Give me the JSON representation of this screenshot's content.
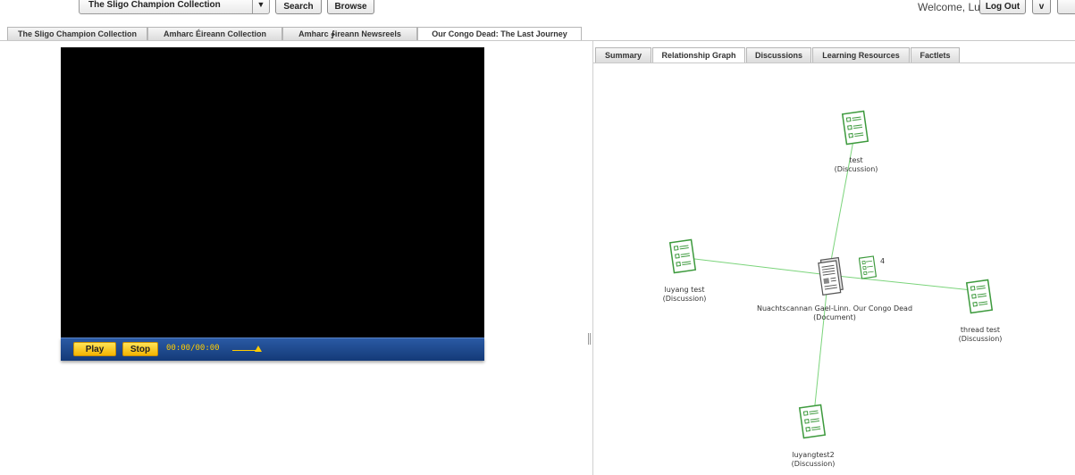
{
  "topbar": {
    "collection_select": "The Sligo Champion Collection",
    "search_label": "Search",
    "browse_label": "Browse",
    "welcome_text": "Welcome, Lu",
    "logout_label": "Log Out"
  },
  "collection_tabs": [
    {
      "label": "The Sligo Champion Collection"
    },
    {
      "label": "Amharc Éireann Collection"
    },
    {
      "label": "Amharc ∲ireann Newsreels"
    },
    {
      "label": "Our Congo Dead: The Last Journey"
    }
  ],
  "player": {
    "play_label": "Play",
    "stop_label": "Stop",
    "timecode": "00:00/00:00"
  },
  "right_tabs": [
    {
      "label": "Summary"
    },
    {
      "label": "Relationship Graph"
    },
    {
      "label": "Discussions"
    },
    {
      "label": "Learning Resources"
    },
    {
      "label": "Factlets"
    }
  ],
  "graph": {
    "center": {
      "name": "Nuachtscannan Gael-Linn.  Our Congo Dead",
      "type": "(Document)"
    },
    "count_badge": "4",
    "nodes": [
      {
        "name": "test",
        "type": "(Discussion)"
      },
      {
        "name": "luyang test",
        "type": "(Discussion)"
      },
      {
        "name": "thread test",
        "type": "(Discussion)"
      },
      {
        "name": "luyangtest2",
        "type": "(Discussion)"
      }
    ]
  },
  "colors": {
    "edge": "#7bd47b",
    "discussion_icon": "#3d9a3d",
    "controls_bar": "#1d4a8e",
    "button_yellow": "#f7c600"
  }
}
